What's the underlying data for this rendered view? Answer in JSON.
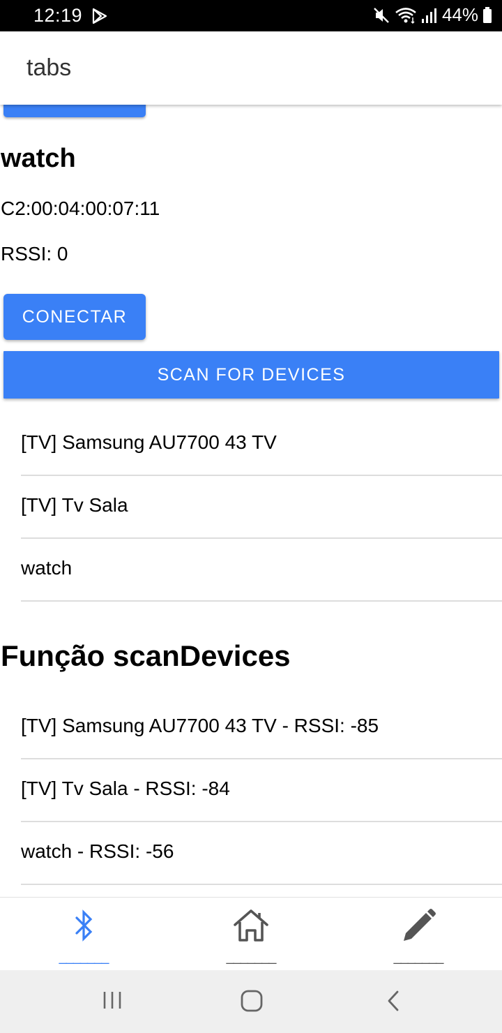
{
  "status_bar": {
    "time": "12:19",
    "battery": "44%",
    "icons": [
      "play-store-icon",
      "mute-icon",
      "wifi-icon",
      "signal-icon",
      "battery-icon"
    ]
  },
  "app_bar": {
    "title": "tabs"
  },
  "device": {
    "name": "watch",
    "mac": "C2:00:04:00:07:11",
    "rssi": "RSSI: 0",
    "connect_label": "CONECTAR"
  },
  "scan_label": "SCAN FOR DEVICES",
  "devices_list": [
    "[TV] Samsung AU7700 43 TV",
    "[TV] Tv Sala",
    "watch"
  ],
  "section_title": "Função scanDevices",
  "scan_results": [
    "[TV] Samsung AU7700 43 TV - RSSI: -85",
    "[TV] Tv Sala - RSSI: -84",
    "watch - RSSI: -56"
  ],
  "tabs": [
    {
      "icon": "bluetooth-icon",
      "label": "_______",
      "active": true
    },
    {
      "icon": "home-icon",
      "label": "_______",
      "active": false
    },
    {
      "icon": "pencil-icon",
      "label": "_______",
      "active": false
    }
  ],
  "colors": {
    "accent": "#3a80f6",
    "status_bar": "#000000",
    "nav_bar": "#efefef"
  }
}
